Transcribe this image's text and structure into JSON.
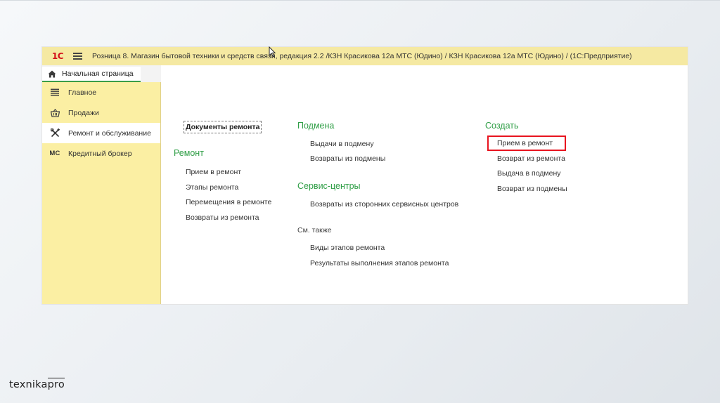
{
  "app": {
    "logo": "1С",
    "title": "Розница 8. Магазин бытовой техники и средств связи, редакция 2.2 /КЗН Красикова 12а МТС (Юдино) / КЗН Красикова 12а МТС (Юдино) /  (1С:Предприятие)"
  },
  "tabs": {
    "home": "Начальная страница"
  },
  "sidebar": {
    "items": [
      {
        "label": "Главное",
        "icon": "menu-lines-icon"
      },
      {
        "label": "Продажи",
        "icon": "basket-icon"
      },
      {
        "label": "Ремонт и обслуживание",
        "icon": "tools-icon",
        "active": true
      },
      {
        "label": "Кредитный брокер",
        "icon": "mc-icon",
        "icon_text": "МС"
      }
    ]
  },
  "content": {
    "documents_link": "Документы ремонта",
    "repair": {
      "title": "Ремонт",
      "items": [
        "Прием в ремонт",
        "Этапы ремонта",
        "Перемещения в ремонте",
        "Возвраты из ремонта"
      ]
    },
    "substitute": {
      "title": "Подмена",
      "items": [
        "Выдачи в подмену",
        "Возвраты из подмены"
      ]
    },
    "service_centers": {
      "title": "Сервис-центры",
      "items": [
        "Возвраты из сторонних сервисных центров"
      ]
    },
    "see_also": {
      "title": "См. также",
      "items": [
        "Виды этапов ремонта",
        "Результаты выполнения этапов ремонта"
      ]
    },
    "create": {
      "title": "Создать",
      "items": [
        "Прием в ремонт",
        "Возврат из ремонта",
        "Выдача в подмену",
        "Возврат из подмены"
      ]
    }
  },
  "colors": {
    "titlebar": "#f5e9a2",
    "sidebar": "#fbefa3",
    "group_title": "#2f9e46",
    "highlight": "#e8141f",
    "logo": "#d3111b"
  },
  "branding": {
    "prefix": "texnika",
    "suffix": "pro"
  }
}
